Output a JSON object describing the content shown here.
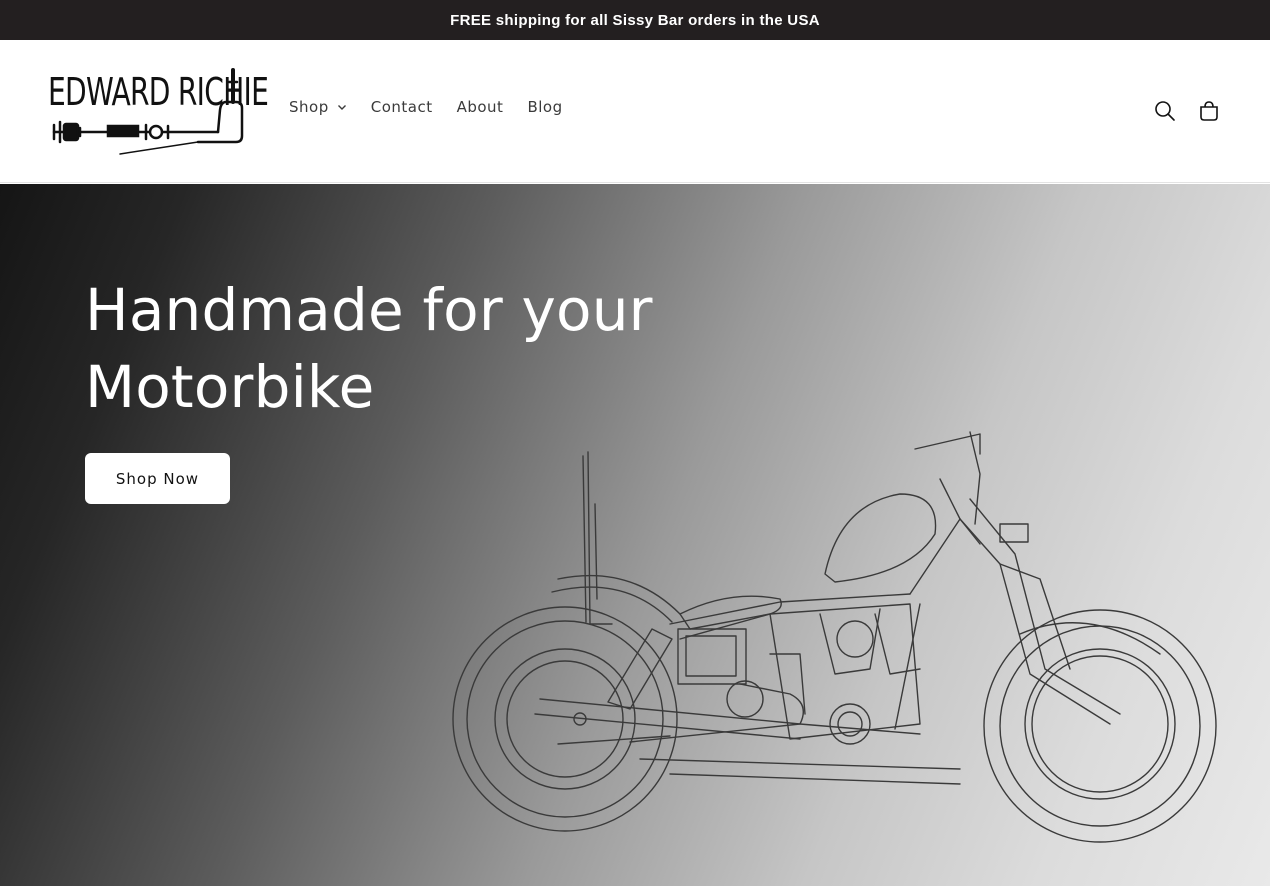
{
  "announcement": {
    "text": "FREE shipping for all Sissy Bar orders in the USA"
  },
  "header": {
    "logo_text": "EDWARD RICHIE",
    "nav": [
      {
        "label": "Shop",
        "has_dropdown": true
      },
      {
        "label": "Contact"
      },
      {
        "label": "About"
      },
      {
        "label": "Blog"
      }
    ],
    "icons": [
      "search-icon",
      "cart-icon"
    ]
  },
  "hero": {
    "title_line1": "Handmade for your",
    "title_line2": "Motorbike",
    "button_label": "Shop Now"
  },
  "colors": {
    "announcement_bg": "#231f20",
    "announcement_text": "#ffffff",
    "hero_dark": "#151515",
    "hero_light": "#e9e9e9"
  }
}
